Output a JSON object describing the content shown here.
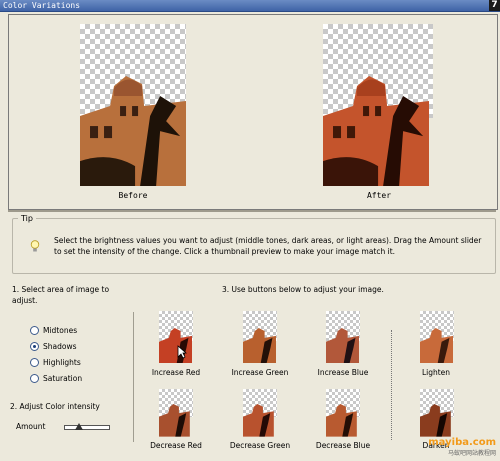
{
  "window": {
    "title": "Color Variations",
    "badge": "7"
  },
  "preview": {
    "before_label": "Before",
    "after_label": "After"
  },
  "tip": {
    "legend": "Tip",
    "text": "Select the brightness values you want to adjust (middle tones, dark areas, or light areas). Drag the Amount slider to set the intensity of the change. Click a thumbnail preview to make your image match it."
  },
  "step1": {
    "label": "1. Select area of image to adjust.",
    "options": [
      {
        "label": "Midtones",
        "selected": false
      },
      {
        "label": "Shadows",
        "selected": true
      },
      {
        "label": "Highlights",
        "selected": false
      },
      {
        "label": "Saturation",
        "selected": false
      }
    ]
  },
  "step2": {
    "label": "2. Adjust Color intensity",
    "amount_label": "Amount",
    "amount_fraction": 0.35
  },
  "step3": {
    "label": "3. Use buttons below to adjust your image."
  },
  "buttons": {
    "increase_red": "Increase Red",
    "increase_green": "Increase Green",
    "increase_blue": "Increase Blue",
    "lighten": "Lighten",
    "decrease_red": "Decrease Red",
    "decrease_green": "Decrease Green",
    "decrease_blue": "Decrease Blue",
    "darken": "Darken"
  },
  "watermark": {
    "site": "mayiba.com",
    "sub": "马蚁吧网站教程网"
  },
  "colors": {
    "titlebar": "#3f63a6",
    "before_tone": "#b86a3a",
    "after_tone": "#c4522a"
  }
}
